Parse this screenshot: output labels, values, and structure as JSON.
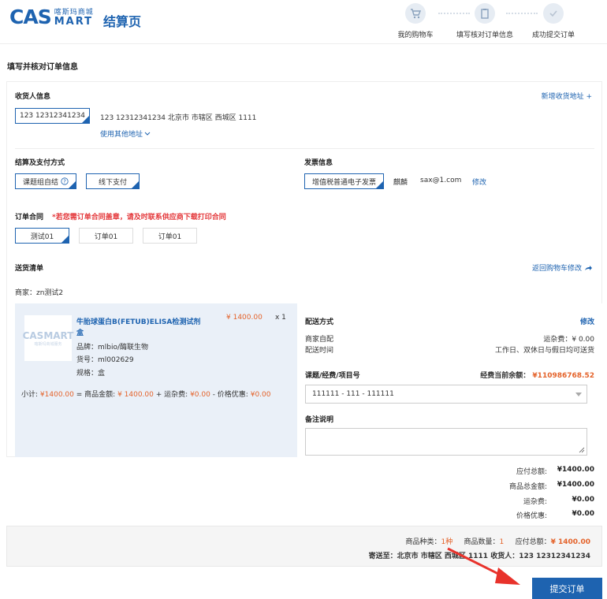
{
  "header": {
    "logo_main": "CAS",
    "logo_cn": "喀斯玛商城",
    "logo_mart": "MART",
    "page_title": "结算页",
    "steps": [
      "我的购物车",
      "填写核对订单信息",
      "成功提交订单"
    ]
  },
  "section_title": "填写并核对订单信息",
  "receiver": {
    "label": "收货人信息",
    "add_link": "新增收货地址 +",
    "selected": "123 12312341234",
    "address": "123 12312341234 北京市 市辖区 西城区 1111",
    "other_link": "使用其他地址"
  },
  "payment": {
    "label": "结算及支付方式",
    "options": [
      "课题组自结",
      "线下支付"
    ]
  },
  "invoice": {
    "label": "发票信息",
    "type": "增值税普通电子发票",
    "title": "麒麟",
    "email": "sax@1.com",
    "edit": "修改"
  },
  "contract": {
    "label": "订单合同",
    "notice": "*若您需订单合同盖章，请及时联系供应商下载打印合同",
    "options": [
      "测试01",
      "订单01",
      "订单01"
    ]
  },
  "delivery": {
    "label": "送货清单",
    "back_link": "返回购物车修改",
    "merchant": "商家：zn测试2"
  },
  "item": {
    "thumb_main": "CASMART",
    "thumb_sub": "喀斯玛商城服务",
    "name_line1": "牛胎球蛋白B(FETUB)ELISA检测试剂",
    "name_line2": "盒",
    "price": "¥ 1400.00",
    "qty": "x 1",
    "brand": "品牌：mlbio/酶联生物",
    "sku": "货号：ml002629",
    "spec": "规格：盒",
    "subtotal_label": "小计:",
    "subtotal": "¥1400.00",
    "eq": "= 商品金额:",
    "goods_amount": "¥ 1400.00",
    "plus_freight": "+ 运杂费:",
    "freight": "¥0.00",
    "minus_discount": "- 价格优惠:",
    "discount": "¥0.00"
  },
  "shipping": {
    "label": "配送方式",
    "edit": "修改",
    "method": "商家自配",
    "freight_label": "运杂费：¥ 0.00",
    "time_label": "配送时间",
    "time_value": "工作日、双休日与假日均可送货"
  },
  "project": {
    "label": "课题/经费/项目号",
    "balance_label": "经费当前余额：",
    "balance": "¥110986768.52",
    "selected": "111111 - 111 - 111111"
  },
  "remarks": {
    "label": "备注说明"
  },
  "summary": {
    "rows": [
      {
        "k": "应付总额:",
        "v": "¥1400.00"
      },
      {
        "k": "商品总金额:",
        "v": "¥1400.00"
      },
      {
        "k": "运杂费:",
        "v": "¥0.00"
      },
      {
        "k": "价格优惠:",
        "v": "¥0.00"
      }
    ]
  },
  "footer": {
    "kinds_label": "商品种类：",
    "kinds": "1种",
    "count_label": "商品数量：",
    "count": "1",
    "total_label": "应付总额：",
    "total": "¥ 1400.00",
    "ship_to": "寄送至：北京市 市辖区 西城区 1111 收货人：123 12312341234"
  },
  "submit": "提交订单",
  "colors": {
    "primary": "#1e63b0",
    "red": "#e4393c",
    "arrow": "#e8322b"
  }
}
